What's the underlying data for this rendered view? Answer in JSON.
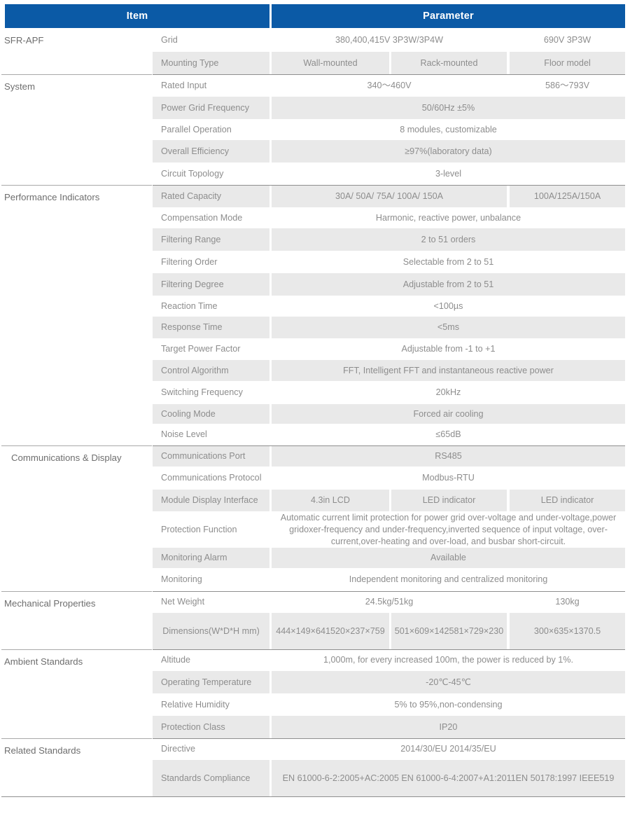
{
  "header": {
    "item_label": "Item",
    "parameter_label": "Parameter",
    "accent_color": "#0b5aa6"
  },
  "colors": {
    "header_bg": "#0b5aa6",
    "header_text": "#ffffff",
    "row_gray": "#e9e9e9",
    "row_white": "#ffffff",
    "text_gray": "#8d8d8d",
    "group_text": "#6e6e6e",
    "rule": "#a9a9a9"
  },
  "groups": {
    "sfr_apf": "SFR-APF",
    "system": "System",
    "performance_indicators": "Performance Indicators",
    "communications_display": "Communications & Display",
    "mechanical_properties": "Mechanical Properties",
    "ambient_standards": "Ambient Standards",
    "related_standards": "Related  Standards"
  },
  "rows": [
    {
      "label": "Grid",
      "layout": "split_2",
      "shade": "white",
      "values": [
        "380,400,415V 3P3W/3P4W",
        "690V 3P3W"
      ]
    },
    {
      "label": "Mounting Type",
      "layout": "split_3",
      "shade": "gray",
      "values": [
        "Wall-mounted",
        "Rack-mounted",
        "Floor model"
      ]
    },
    {
      "label": "Rated Input",
      "layout": "split_2",
      "shade": "white",
      "values": [
        "340～460V",
        "586～793V"
      ]
    },
    {
      "label": "Power Grid Frequency",
      "layout": "full",
      "shade": "gray",
      "values": [
        "50/60Hz ±5%"
      ]
    },
    {
      "label": "Parallel Operation",
      "layout": "full",
      "shade": "white",
      "values": [
        "8 modules, customizable"
      ]
    },
    {
      "label": "Overall Efficiency",
      "layout": "full",
      "shade": "gray",
      "values": [
        "≥97%(laboratory data)"
      ]
    },
    {
      "label": "Circuit Topology",
      "layout": "full",
      "shade": "white",
      "values": [
        "3-level"
      ]
    },
    {
      "label": "Rated Capacity",
      "layout": "split_12_3",
      "shade": "gray",
      "values": [
        "30A/ 50A/ 75A/ 100A/ 150A",
        "100A/125A/150A"
      ]
    },
    {
      "label": "Compensation Mode",
      "layout": "full",
      "shade": "white",
      "values": [
        "Harmonic, reactive power, unbalance"
      ]
    },
    {
      "label": "Filtering Range",
      "layout": "full",
      "shade": "gray",
      "values": [
        "2 to 51  orders"
      ]
    },
    {
      "label": "Filtering Order",
      "layout": "full",
      "shade": "white",
      "values": [
        "Selectable from 2 to 51"
      ]
    },
    {
      "label": "Filtering Degree",
      "layout": "full",
      "shade": "gray",
      "values": [
        "Adjustable from 2 to 51"
      ]
    },
    {
      "label": "Reaction Time",
      "layout": "full",
      "shade": "white",
      "values": [
        "<100µs"
      ]
    },
    {
      "label": "Response Time",
      "layout": "full",
      "shade": "gray",
      "values": [
        "<5ms"
      ]
    },
    {
      "label": "Target Power Factor",
      "layout": "full",
      "shade": "white",
      "values": [
        "Adjustable from -1 to +1"
      ]
    },
    {
      "label": "Control Algorithm",
      "layout": "full",
      "shade": "gray",
      "values": [
        "FFT, Intelligent FFT and instantaneous reactive power"
      ]
    },
    {
      "label": "Switching Frequency",
      "layout": "full",
      "shade": "white",
      "values": [
        "20kHz"
      ]
    },
    {
      "label": "Cooling Mode",
      "layout": "full",
      "shade": "gray",
      "values": [
        "Forced air cooling"
      ]
    },
    {
      "label": "Noise Level",
      "layout": "full",
      "shade": "white",
      "values": [
        "≤65dB"
      ]
    },
    {
      "label": "Communications Port",
      "layout": "full",
      "shade": "gray",
      "values": [
        "RS485"
      ]
    },
    {
      "label": "Communications Protocol",
      "layout": "full",
      "shade": "white",
      "values": [
        "Modbus-RTU"
      ]
    },
    {
      "label": "Module Display Interface",
      "layout": "split_3",
      "shade": "gray",
      "values": [
        "4.3in LCD",
        "LED indicator",
        "LED indicator"
      ]
    },
    {
      "label": "Protection Function",
      "layout": "full",
      "shade": "white",
      "values": [
        "Automatic current limit protection for power grid over-voltage and under-voltage,power gridoxer-frequency and under-frequency,inverted sequence of input voltage, over-current,over-heating and over-load, and busbar short-circuit."
      ]
    },
    {
      "label": "Monitoring Alarm",
      "layout": "full",
      "shade": "gray",
      "values": [
        "Available"
      ]
    },
    {
      "label": "Monitoring",
      "layout": "full",
      "shade": "white",
      "values": [
        "Independent monitoring and centralized monitoring"
      ]
    },
    {
      "label": "Net Weight",
      "layout": "split_2",
      "shade": "white",
      "values": [
        "24.5kg/51kg",
        "130kg"
      ]
    },
    {
      "label": "Dimensions\n(W*D*H mm)",
      "layout": "split_3",
      "shade": "gray",
      "values": [
        "444×149×641\n520×237×759",
        "501×609×142\n581×729×230",
        "300×635×1370.5"
      ]
    },
    {
      "label": "Altitude",
      "layout": "full",
      "shade": "white",
      "values": [
        "1,000m, for every increased 100m, the power is reduced by 1%."
      ]
    },
    {
      "label": "Operating Temperature",
      "layout": "full",
      "shade": "gray",
      "values": [
        "-20℃-45℃"
      ]
    },
    {
      "label": "Relative Humidity",
      "layout": "full",
      "shade": "white",
      "values": [
        "5% to 95%,non-condensing"
      ]
    },
    {
      "label": "Protection Class",
      "layout": "full",
      "shade": "gray",
      "values": [
        "IP20"
      ]
    },
    {
      "label": "Directive",
      "layout": "full",
      "shade": "white",
      "values": [
        "2014/30/EU  2014/35/EU"
      ]
    },
    {
      "label": "Standards Compliance",
      "layout": "full",
      "shade": "gray",
      "values": [
        "EN 61000-6-2:2005+AC:2005  EN 61000-6-4:2007+A1:2011\nEN 50178:1997  IEEE519"
      ]
    }
  ]
}
